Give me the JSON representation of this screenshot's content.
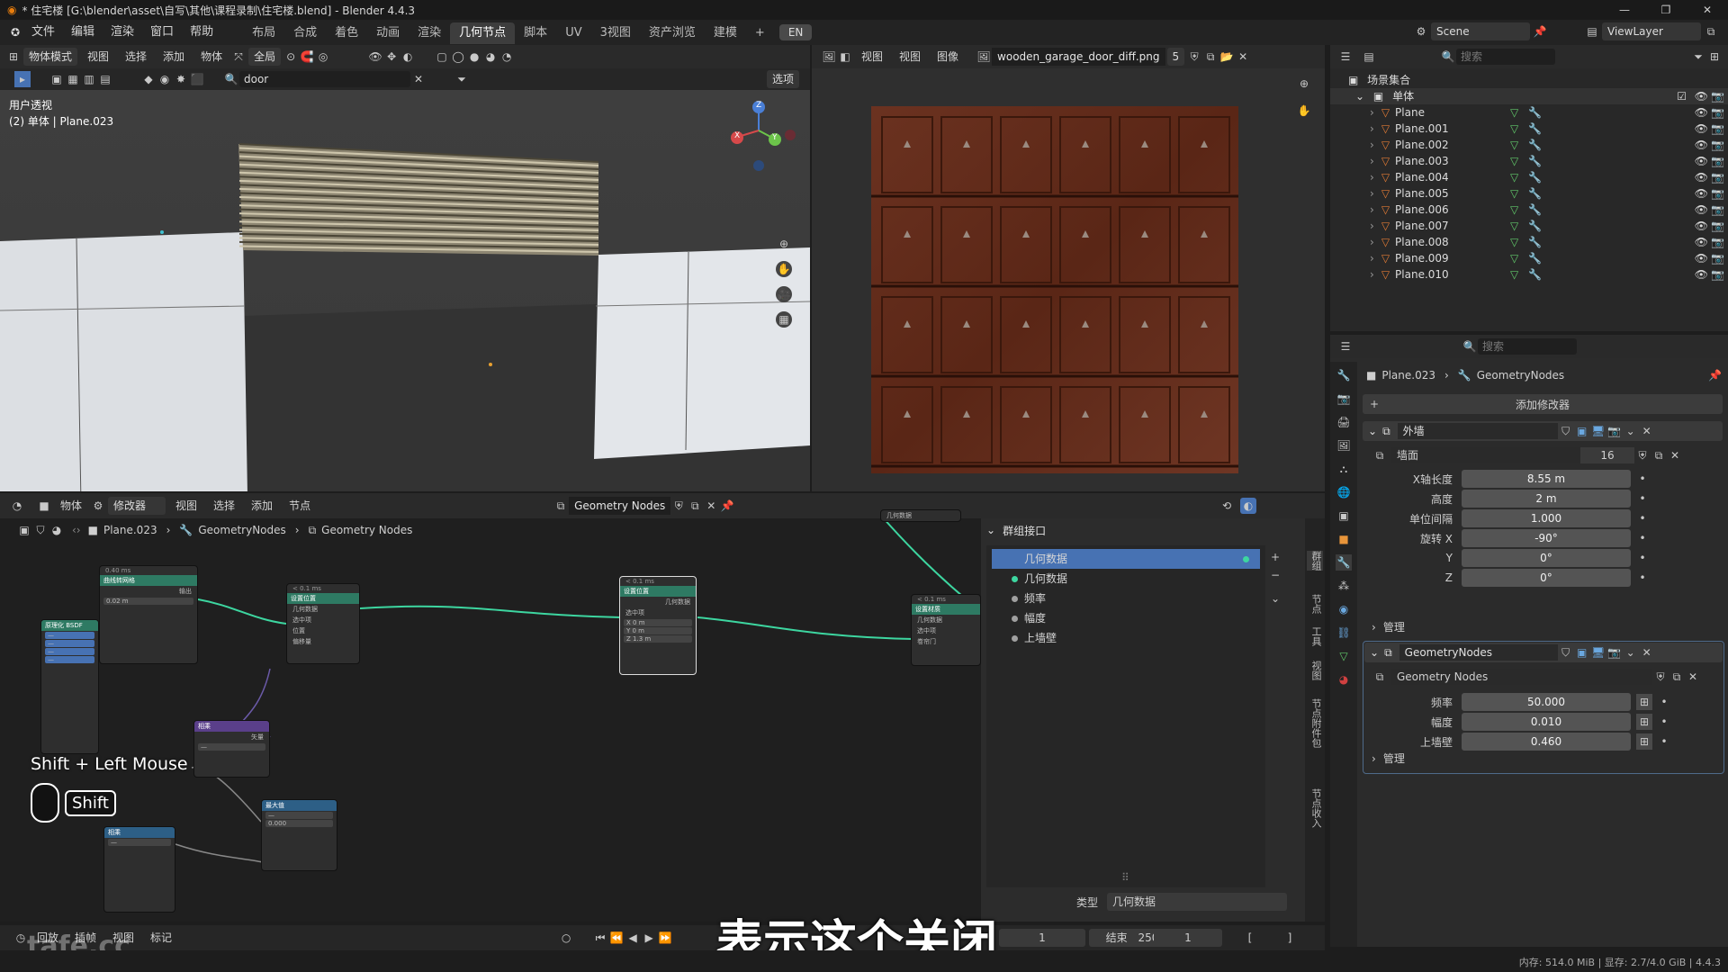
{
  "window": {
    "title": "* 住宅楼 [G:\\blender\\asset\\自写\\其他\\课程录制\\住宅楼.blend] - Blender 4.4.3",
    "controls": [
      "—",
      "❐",
      "✕"
    ]
  },
  "menubar": {
    "items": [
      "文件",
      "编辑",
      "渲染",
      "窗口",
      "帮助"
    ],
    "workspaces": [
      "布局",
      "合成",
      "着色",
      "动画",
      "渲染",
      "几何节点",
      "脚本",
      "UV",
      "3视图",
      "资产浏览",
      "建模"
    ],
    "active_workspace": "几何节点",
    "add_tab": "+",
    "lang": "EN",
    "scene": "Scene",
    "view_layer": "ViewLayer"
  },
  "viewport": {
    "mode": "物体模式",
    "menus": [
      "视图",
      "选择",
      "添加",
      "物体"
    ],
    "transform": "全局",
    "search_value": "door",
    "options_label": "选项",
    "view_name": "用户透视",
    "object_info": "(2) 单体 | Plane.023",
    "gizmo": {
      "x": "X",
      "y": "Y",
      "z": "Z"
    }
  },
  "image_editor": {
    "menus": [
      "视图",
      "视图",
      "图像"
    ],
    "image_name": "wooden_garage_door_diff.png",
    "users": "5"
  },
  "outliner": {
    "search_placeholder": "搜索",
    "collection": "场景集合",
    "parent": "单体",
    "objects": [
      "Plane",
      "Plane.001",
      "Plane.002",
      "Plane.003",
      "Plane.004",
      "Plane.005",
      "Plane.006",
      "Plane.007",
      "Plane.008",
      "Plane.009",
      "Plane.010"
    ]
  },
  "node_editor": {
    "header_menus": [
      "物体",
      "修改器",
      "视图",
      "选择",
      "添加",
      "节点"
    ],
    "tree_name": "Geometry Nodes",
    "breadcrumb": [
      "Plane.023",
      "GeometryNodes",
      "Geometry Nodes"
    ],
    "side_tabs": [
      "群组",
      "节点",
      "工具",
      "视图",
      "节点附件包",
      "节点收入"
    ],
    "group_interface": {
      "title": "群组接口",
      "items": [
        {
          "label": "几何数据",
          "selected": true,
          "color": "#3dd6a0"
        },
        {
          "label": "几何数据",
          "selected": false,
          "color": "#3dd6a0"
        },
        {
          "label": "频率",
          "selected": false,
          "color": "#a0a0a0"
        },
        {
          "label": "幅度",
          "selected": false,
          "color": "#a0a0a0"
        },
        {
          "label": "上墙壁",
          "selected": false,
          "color": "#a0a0a0"
        }
      ],
      "type_label": "类型",
      "type_value": "几何数据"
    },
    "nodes": {
      "n1_time": "0.40 ms",
      "n1_title": "曲线转网格",
      "n1_out": "输出",
      "n1_field": "0.02 m",
      "n2_time": "< 0.1 ms",
      "n2_title": "设置位置",
      "n2_in": "几何数据",
      "n2_sel": "选中项",
      "n2_pos": "位置",
      "n2_off": "偏移量",
      "n3_time": "< 0.1 ms",
      "n3_title": "设置位置",
      "n3_x": "X 0 m",
      "n3_y": "Y 0 m",
      "n3_z": "Z 1.3 m",
      "n4_time": "< 0.1 ms",
      "n4_title": "设置材质",
      "n4_mat": "卷帘门",
      "bsdf": "原理化 BSDF",
      "vec": "矢量",
      "maxn": "最大值",
      "mult": "相乘",
      "out_top": "几何数据"
    },
    "overlay_hint": "Shift + Left Mouse",
    "overlay_key": "Shift"
  },
  "properties": {
    "breadcrumb": [
      "Plane.023",
      "GeometryNodes"
    ],
    "add_modifier": "添加修改器",
    "mod1": {
      "name": "外墙",
      "node_group": "墙面",
      "users": "16",
      "fields": [
        {
          "label": "X轴长度",
          "value": "8.55 m"
        },
        {
          "label": "高度",
          "value": "2 m"
        },
        {
          "label": "单位间隔",
          "value": "1.000"
        },
        {
          "label": "旋转 X",
          "value": "-90°"
        },
        {
          "label": "Y",
          "value": "0°"
        },
        {
          "label": "Z",
          "value": "0°"
        }
      ],
      "manage": "管理"
    },
    "mod2": {
      "name": "GeometryNodes",
      "node_group": "Geometry Nodes",
      "fields": [
        {
          "label": "频率",
          "value": "50.000"
        },
        {
          "label": "幅度",
          "value": "0.010"
        },
        {
          "label": "上墙壁",
          "value": "0.460"
        }
      ],
      "manage": "管理"
    }
  },
  "timeline": {
    "menus": [
      "回放",
      "插帧",
      "视图",
      "标记"
    ],
    "current": "1",
    "end_label": "结束",
    "end": "250",
    "frame": "1",
    "subtitle": "表示这个关闭",
    "watermark": "tafe.cc"
  },
  "statusbar": {
    "text": "内存: 514.0 MiB | 显存: 2.7/4.0 GiB | 4.4.3"
  }
}
